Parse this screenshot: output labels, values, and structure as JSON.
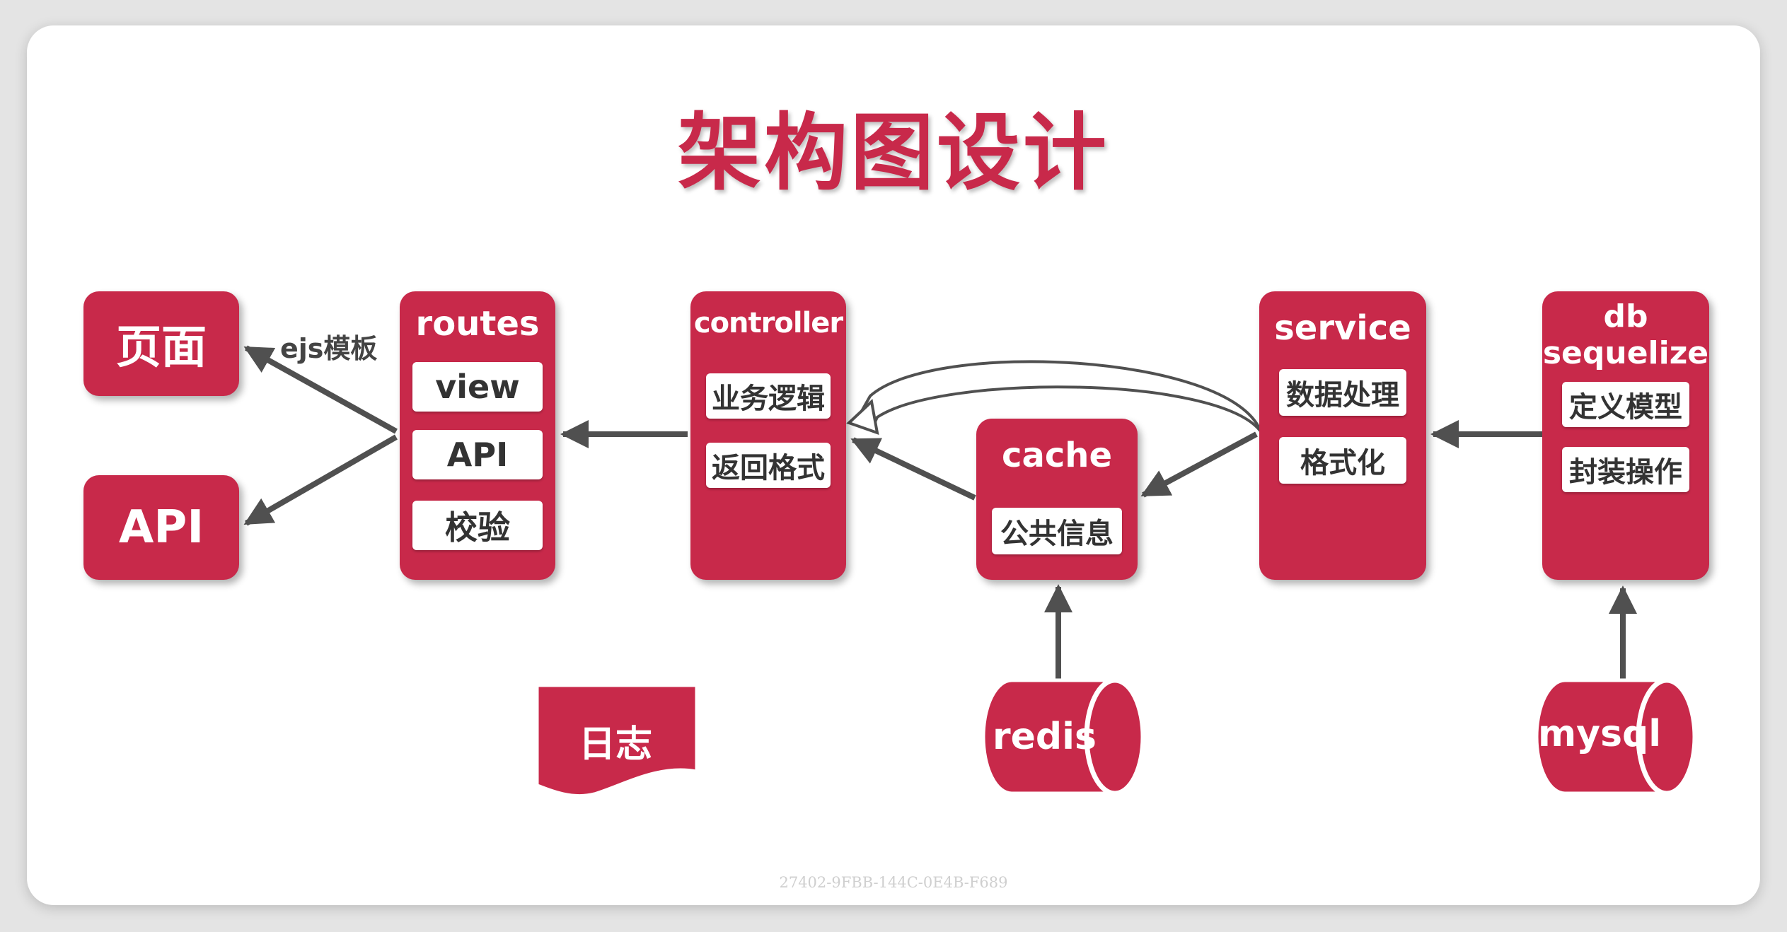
{
  "title": "架构图设计",
  "colors": {
    "accent": "#c8294a",
    "arrow": "#505050",
    "card": "#ffffff"
  },
  "nodes": {
    "page": "页面",
    "api": "API",
    "routes": {
      "title": "routes",
      "items": [
        "view",
        "API",
        "校验"
      ]
    },
    "controller": {
      "title": "controller",
      "items": [
        "业务逻辑",
        "返回格式"
      ]
    },
    "cache": {
      "title": "cache",
      "items": [
        "公共信息"
      ]
    },
    "service": {
      "title": "service",
      "items": [
        "数据处理",
        "格式化"
      ]
    },
    "db": {
      "title_line1": "db",
      "title_line2": "sequelize",
      "items": [
        "定义模型",
        "封装操作"
      ]
    },
    "redis": "redis",
    "mysql": "mysql",
    "log": "日志"
  },
  "edge_labels": {
    "ejs": "ejs模板"
  },
  "watermark": "27402-9FBB-144C-0E4B-F689"
}
